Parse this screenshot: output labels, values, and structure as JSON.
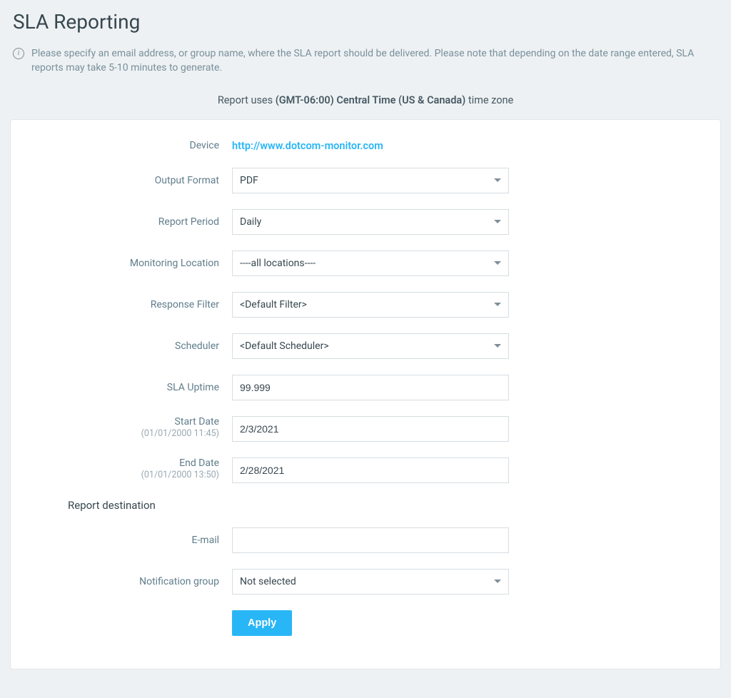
{
  "page": {
    "title": "SLA Reporting",
    "info_text": "Please specify an email address, or group name, where the SLA report should be delivered. Please note that depending on the date range entered, SLA reports may take 5-10 minutes to generate.",
    "timezone_prefix": "Report uses ",
    "timezone_value": "(GMT-06:00) Central Time (US & Canada)",
    "timezone_suffix": " time zone"
  },
  "form": {
    "device": {
      "label": "Device",
      "value": "http://www.dotcom-monitor.com"
    },
    "output_format": {
      "label": "Output Format",
      "value": "PDF"
    },
    "report_period": {
      "label": "Report Period",
      "value": "Daily"
    },
    "monitoring_location": {
      "label": "Monitoring Location",
      "value": "----all locations----"
    },
    "response_filter": {
      "label": "Response Filter",
      "value": "<Default Filter>"
    },
    "scheduler": {
      "label": "Scheduler",
      "value": "<Default Scheduler>"
    },
    "sla_uptime": {
      "label": "SLA Uptime",
      "value": "99.999"
    },
    "start_date": {
      "label": "Start Date",
      "hint": "(01/01/2000 11:45)",
      "value": "2/3/2021"
    },
    "end_date": {
      "label": "End Date",
      "hint": "(01/01/2000 13:50)",
      "value": "2/28/2021"
    }
  },
  "destination": {
    "heading": "Report destination",
    "email": {
      "label": "E-mail",
      "value": ""
    },
    "notification_group": {
      "label": "Notification group",
      "value": "Not selected"
    }
  },
  "actions": {
    "apply": "Apply"
  }
}
